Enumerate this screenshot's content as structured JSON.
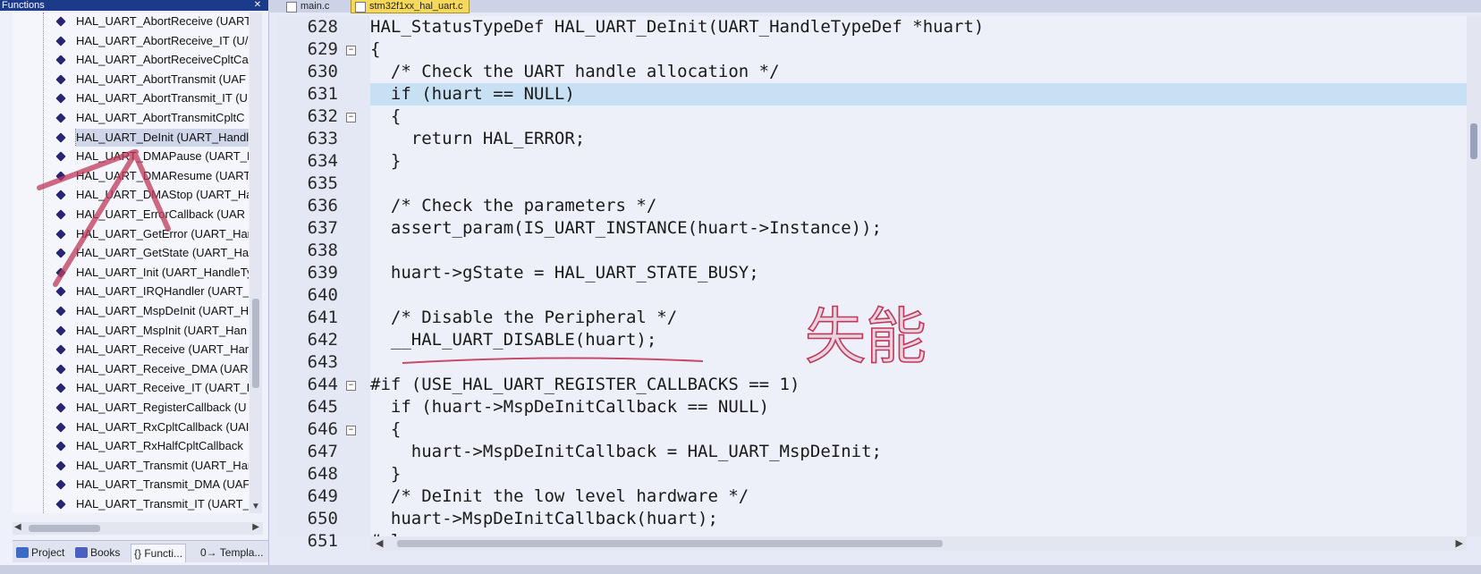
{
  "functions_panel": {
    "title": "Functions",
    "close_glyph": "✕",
    "items": [
      "HAL_UART_AbortReceive (UART",
      "HAL_UART_AbortReceive_IT (U/",
      "HAL_UART_AbortReceiveCpltCa",
      "HAL_UART_AbortTransmit (UAF",
      "HAL_UART_AbortTransmit_IT (U",
      "HAL_UART_AbortTransmitCpltC",
      "HAL_UART_DeInit (UART_Handl",
      "HAL_UART_DMAPause (UART_H",
      "HAL_UART_DMAResume (UART",
      "HAL_UART_DMAStop (UART_Ha",
      "HAL_UART_ErrorCallback (UAR",
      "HAL_UART_GetError (UART_Har",
      "HAL_UART_GetState (UART_Har",
      "HAL_UART_Init (UART_HandleTy",
      "HAL_UART_IRQHandler (UART_",
      "HAL_UART_MspDeInit (UART_H",
      "HAL_UART_MspInit (UART_Han",
      "HAL_UART_Receive (UART_Han",
      "HAL_UART_Receive_DMA (UAR",
      "HAL_UART_Receive_IT (UART_H",
      "HAL_UART_RegisterCallback (U",
      "HAL_UART_RxCpltCallback (UAI",
      "HAL_UART_RxHalfCpltCallback",
      "HAL_UART_Transmit (UART_Har",
      "HAL_UART_Transmit_DMA (UAF",
      "HAL_UART_Transmit_IT (UART_I"
    ],
    "selected_item": "HAL_UART_DeInit (UART_Handl",
    "tabs": [
      {
        "label": "Project",
        "icon": "project-icon",
        "color": "#3c6bc4"
      },
      {
        "label": "Books",
        "icon": "books-icon",
        "color": "#4a5fc0"
      },
      {
        "label": "{} Functi...",
        "icon": "functions-icon",
        "color": ""
      },
      {
        "label": "0→ Templa...",
        "icon": "templates-icon",
        "color": ""
      }
    ]
  },
  "editor": {
    "tabs": [
      {
        "label": "main.c",
        "active": false
      },
      {
        "label": "stm32f1xx_hal_uart.c",
        "active": true
      }
    ],
    "lines": [
      {
        "n": "628",
        "fold": "",
        "code": "HAL_StatusTypeDef HAL_UART_DeInit(UART_HandleTypeDef *huart)"
      },
      {
        "n": "629",
        "fold": "−",
        "code": "{"
      },
      {
        "n": "630",
        "fold": "",
        "code": "  /* Check the UART handle allocation */"
      },
      {
        "n": "631",
        "fold": "",
        "code": "  if (huart == NULL)"
      },
      {
        "n": "632",
        "fold": "−",
        "code": "  {"
      },
      {
        "n": "633",
        "fold": "",
        "code": "    return HAL_ERROR;"
      },
      {
        "n": "634",
        "fold": "",
        "code": "  }"
      },
      {
        "n": "635",
        "fold": "",
        "code": ""
      },
      {
        "n": "636",
        "fold": "",
        "code": "  /* Check the parameters */"
      },
      {
        "n": "637",
        "fold": "",
        "code": "  assert_param(IS_UART_INSTANCE(huart->Instance));"
      },
      {
        "n": "638",
        "fold": "",
        "code": ""
      },
      {
        "n": "639",
        "fold": "",
        "code": "  huart->gState = HAL_UART_STATE_BUSY;"
      },
      {
        "n": "640",
        "fold": "",
        "code": ""
      },
      {
        "n": "641",
        "fold": "",
        "code": "  /* Disable the Peripheral */"
      },
      {
        "n": "642",
        "fold": "",
        "code": "  __HAL_UART_DISABLE(huart);"
      },
      {
        "n": "643",
        "fold": "",
        "code": ""
      },
      {
        "n": "644",
        "fold": "−",
        "code": "#if (USE_HAL_UART_REGISTER_CALLBACKS == 1)"
      },
      {
        "n": "645",
        "fold": "",
        "code": "  if (huart->MspDeInitCallback == NULL)"
      },
      {
        "n": "646",
        "fold": "−",
        "code": "  {"
      },
      {
        "n": "647",
        "fold": "",
        "code": "    huart->MspDeInitCallback = HAL_UART_MspDeInit;"
      },
      {
        "n": "648",
        "fold": "",
        "code": "  }"
      },
      {
        "n": "649",
        "fold": "",
        "code": "  /* DeInit the low level hardware */"
      },
      {
        "n": "650",
        "fold": "",
        "code": "  huart->MspDeInitCallback(huart);"
      },
      {
        "n": "651",
        "fold": "",
        "code": "#else"
      }
    ],
    "highlighted_line": "631"
  },
  "annotation": {
    "handwritten_text": "失能",
    "color": "#c0395a"
  }
}
